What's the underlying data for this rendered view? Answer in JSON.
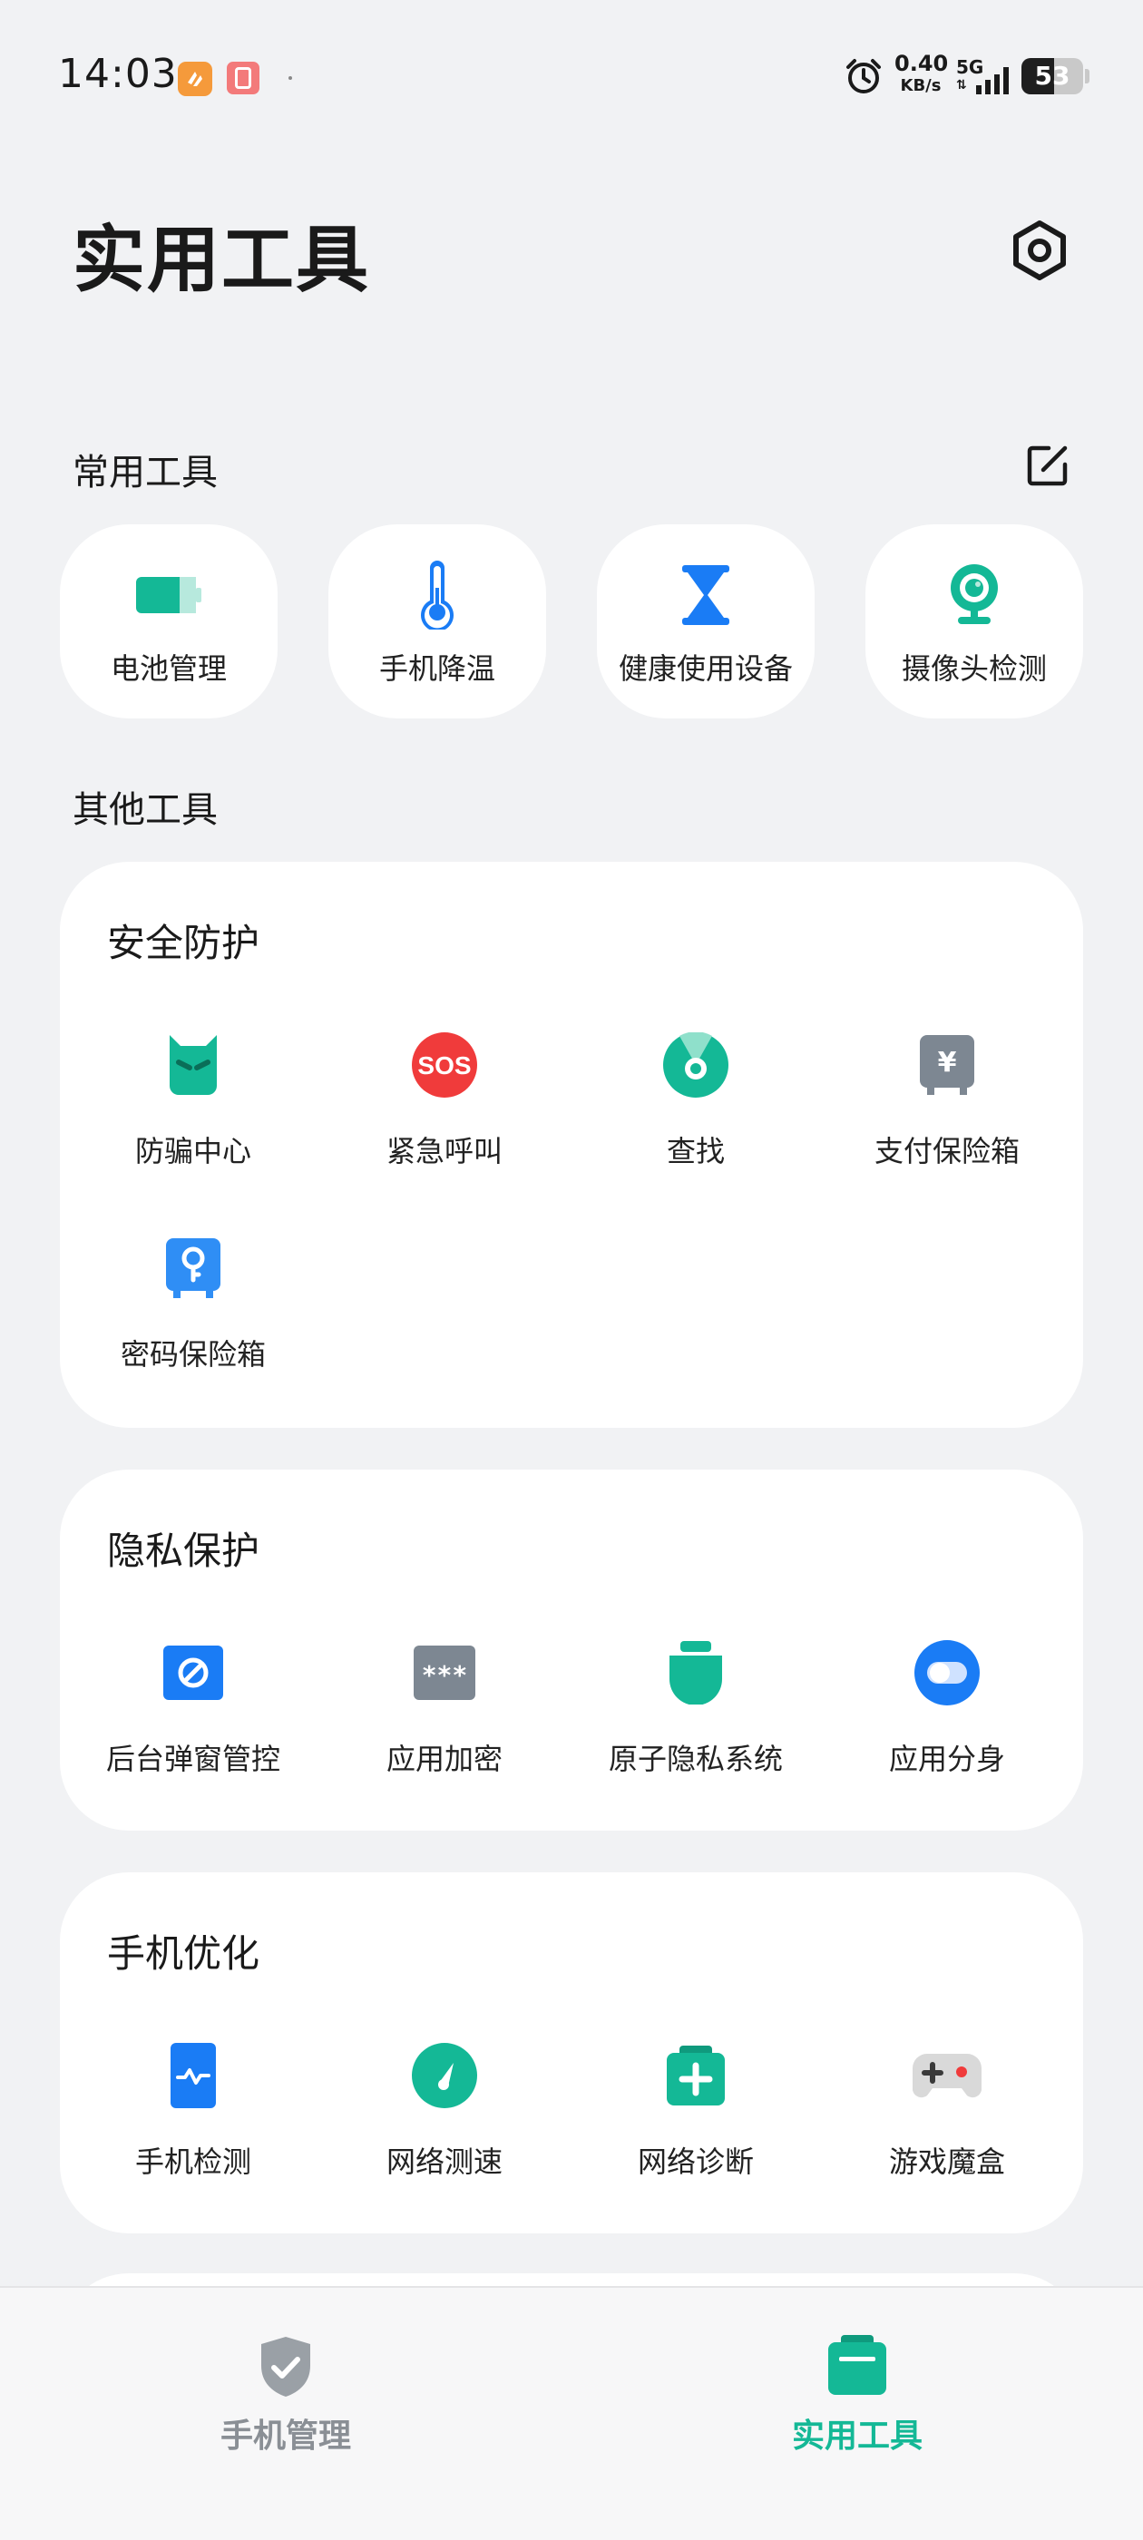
{
  "status_bar": {
    "time": "14:03",
    "notification_badge": "0",
    "net_speed_value": "0.40",
    "net_speed_unit": "KB/s",
    "network": "5G",
    "battery_level": "53"
  },
  "header": {
    "title": "实用工具"
  },
  "common_tools": {
    "label": "常用工具",
    "items": [
      {
        "label": "电池管理",
        "icon": "battery-icon"
      },
      {
        "label": "手机降温",
        "icon": "thermometer-icon"
      },
      {
        "label": "健康使用设备",
        "icon": "hourglass-icon"
      },
      {
        "label": "摄像头检测",
        "icon": "camera-icon"
      }
    ]
  },
  "other_tools": {
    "label": "其他工具"
  },
  "security": {
    "title": "安全防护",
    "items": [
      {
        "label": "防骗中心",
        "icon": "anti-fraud-icon"
      },
      {
        "label": "紧急呼叫",
        "icon": "sos-icon"
      },
      {
        "label": "查找",
        "icon": "find-device-icon"
      },
      {
        "label": "支付保险箱",
        "icon": "payment-safe-icon"
      },
      {
        "label": "密码保险箱",
        "icon": "password-safe-icon"
      }
    ]
  },
  "privacy": {
    "title": "隐私保护",
    "items": [
      {
        "label": "后台弹窗管控",
        "icon": "popup-block-icon"
      },
      {
        "label": "应用加密",
        "icon": "app-lock-icon"
      },
      {
        "label": "原子隐私系统",
        "icon": "atomic-privacy-icon"
      },
      {
        "label": "应用分身",
        "icon": "app-clone-icon"
      }
    ]
  },
  "optimization": {
    "title": "手机优化",
    "items": [
      {
        "label": "手机检测",
        "icon": "phone-check-icon"
      },
      {
        "label": "网络测速",
        "icon": "speed-test-icon"
      },
      {
        "label": "网络诊断",
        "icon": "network-diagnosis-icon"
      },
      {
        "label": "游戏魔盒",
        "icon": "game-box-icon"
      }
    ]
  },
  "bottom_nav": {
    "items": [
      {
        "label": "手机管理",
        "active": false
      },
      {
        "label": "实用工具",
        "active": true
      }
    ]
  },
  "colors": {
    "accent": "#14b896",
    "background": "#f1f2f4",
    "blue": "#1a7cf5",
    "red": "#f03b3b",
    "gray_icon": "#7d8792"
  }
}
